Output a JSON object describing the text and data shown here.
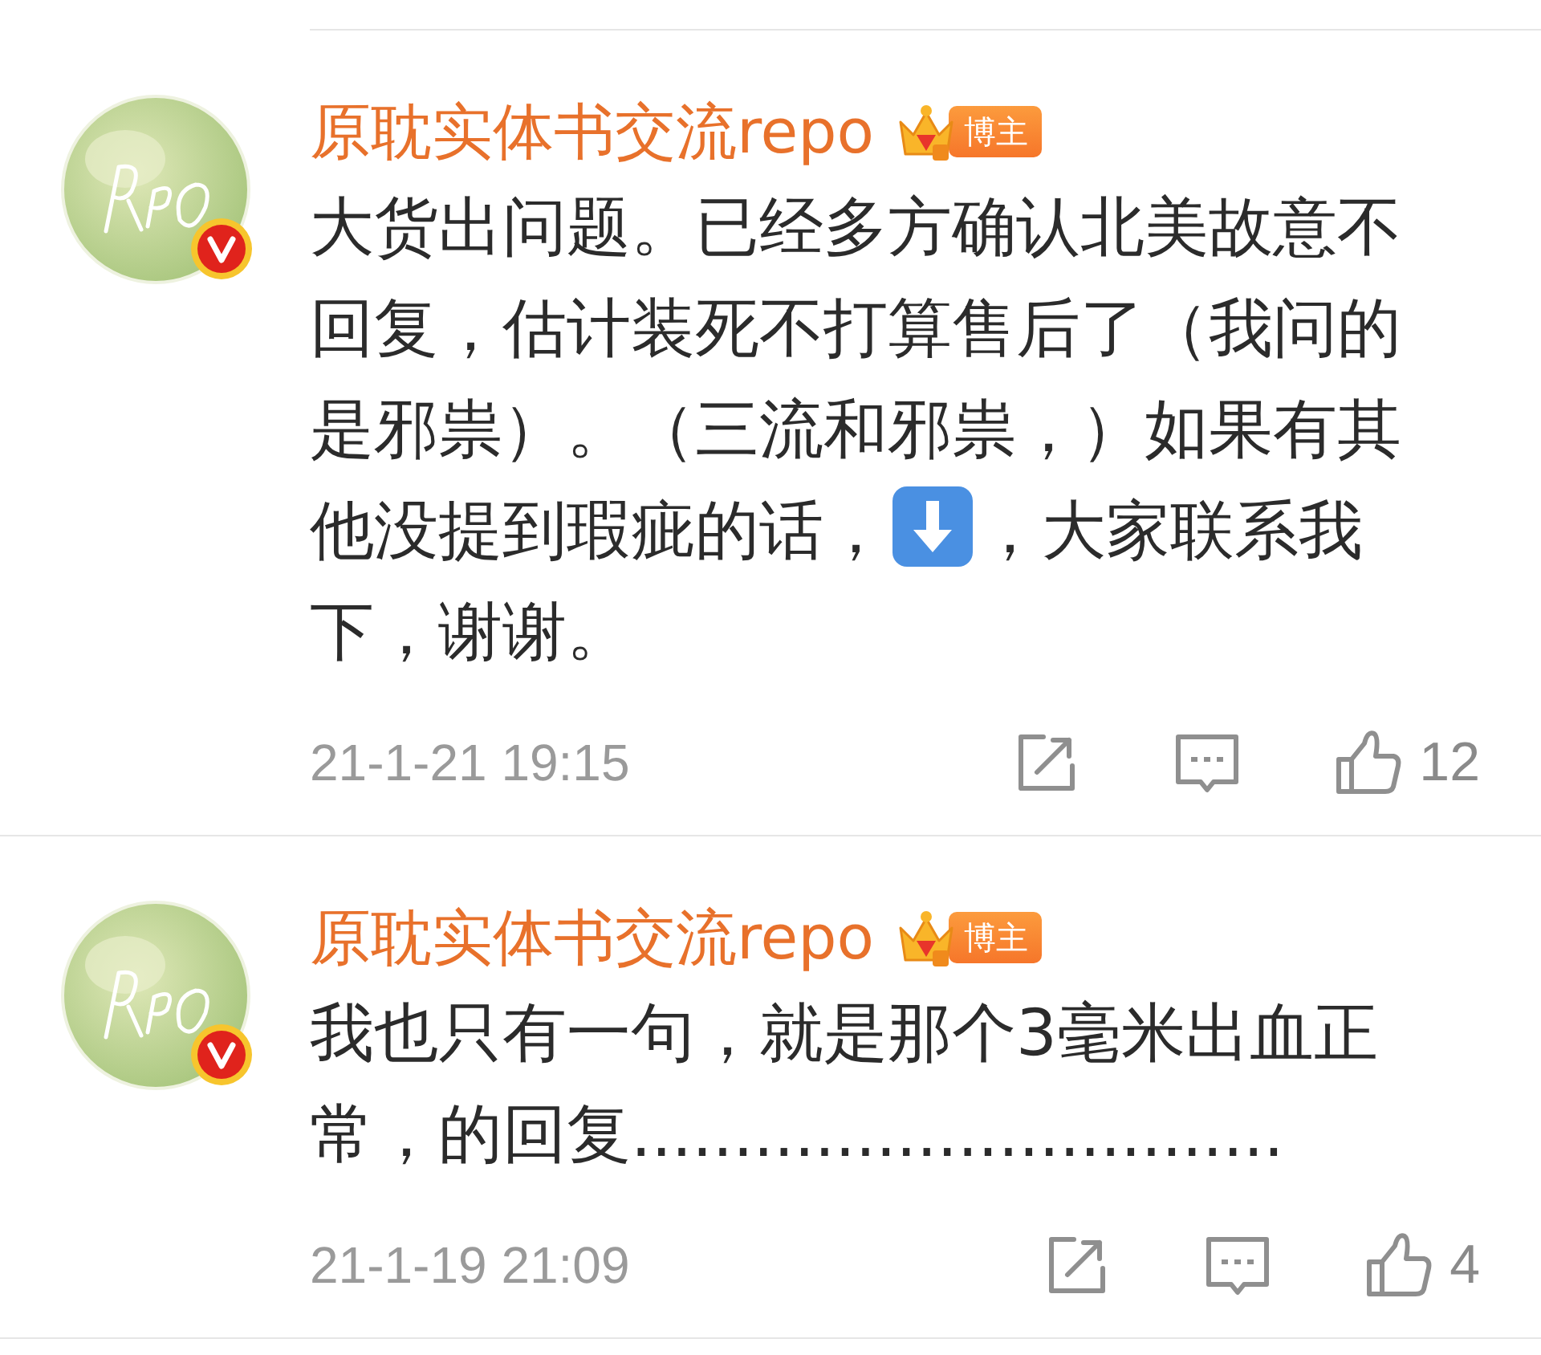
{
  "comments": [
    {
      "author": "原耽实体书交流repo",
      "badge": "博主",
      "verified": true,
      "lines": [
        [
          {
            "kind": "text",
            "text": "大货出问题。已经多方确认北美故意不"
          }
        ],
        [
          {
            "kind": "text",
            "text": "回复，估计装死不打算售后了（我问的"
          }
        ],
        [
          {
            "kind": "text",
            "text": "是邪祟）。（三流和邪祟，）如果有其"
          }
        ],
        [
          {
            "kind": "text",
            "text": "他没提到瑕疵的话，"
          },
          {
            "kind": "down-arrow"
          },
          {
            "kind": "text",
            "text": "，大家联系我"
          }
        ],
        [
          {
            "kind": "text",
            "text": "下，谢谢。"
          }
        ]
      ],
      "time": "21-1-21 19:15",
      "likes": "12"
    },
    {
      "author": "原耽实体书交流repo",
      "badge": "博主",
      "verified": true,
      "lines": [
        [
          {
            "kind": "text",
            "text": "我也只有一句，就是那个3毫米出血正"
          }
        ],
        [
          {
            "kind": "text",
            "text": "常，的回复................................"
          }
        ]
      ],
      "time": "21-1-19 21:09",
      "likes": "4"
    }
  ]
}
